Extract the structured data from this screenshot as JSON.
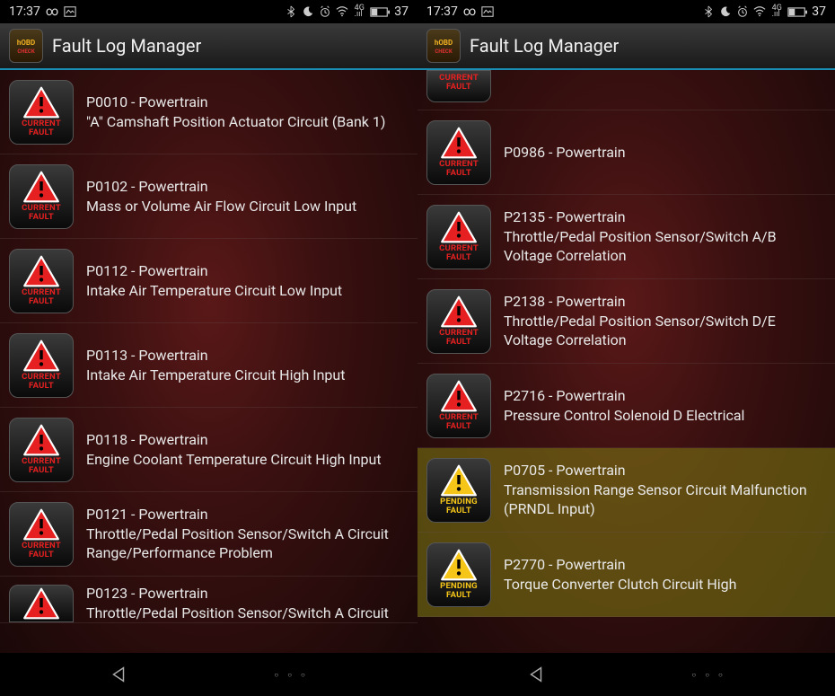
{
  "status": {
    "time": "17:37",
    "infinity": "∞",
    "battery_pct": "37"
  },
  "header": {
    "title": "Fault Log Manager"
  },
  "icon_labels": {
    "current": "CURRENT\nFAULT",
    "pending": "PENDING\nFAULT"
  },
  "left": {
    "faults": [
      {
        "code": "P0010 - Powertrain",
        "desc": "\"A\" Camshaft Position Actuator Circuit (Bank 1)",
        "type": "current"
      },
      {
        "code": "P0102 - Powertrain",
        "desc": "Mass or Volume Air Flow Circuit Low Input",
        "type": "current"
      },
      {
        "code": "P0112 - Powertrain",
        "desc": "Intake Air Temperature Circuit Low Input",
        "type": "current"
      },
      {
        "code": "P0113 - Powertrain",
        "desc": "Intake Air Temperature Circuit High Input",
        "type": "current"
      },
      {
        "code": "P0118 - Powertrain",
        "desc": "Engine Coolant Temperature Circuit High Input",
        "type": "current"
      },
      {
        "code": "P0121 - Powertrain",
        "desc": "Throttle/Pedal Position Sensor/Switch A Circuit Range/Performance Problem",
        "type": "current"
      },
      {
        "code": "P0123 - Powertrain",
        "desc": "Throttle/Pedal Position Sensor/Switch A Circuit",
        "type": "current"
      }
    ]
  },
  "right": {
    "partial_top": {
      "type": "current"
    },
    "faults": [
      {
        "code": "P0986 - Powertrain",
        "desc": "",
        "type": "current"
      },
      {
        "code": "P2135 - Powertrain",
        "desc": "Throttle/Pedal Position Sensor/Switch A/B Voltage Correlation",
        "type": "current"
      },
      {
        "code": "P2138 - Powertrain",
        "desc": "Throttle/Pedal Position Sensor/Switch D/E Voltage Correlation",
        "type": "current"
      },
      {
        "code": "P2716 - Powertrain",
        "desc": "Pressure Control Solenoid D Electrical",
        "type": "current"
      },
      {
        "code": "P0705 - Powertrain",
        "desc": "Transmission Range Sensor Circuit Malfunction (PRNDL Input)",
        "type": "pending"
      },
      {
        "code": "P2770 - Powertrain",
        "desc": "Torque Converter Clutch Circuit High",
        "type": "pending"
      }
    ]
  }
}
